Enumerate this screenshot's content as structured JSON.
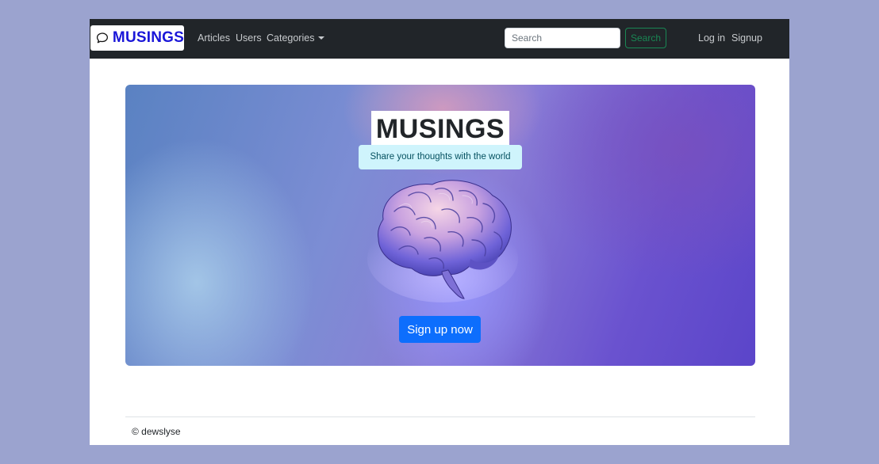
{
  "navbar": {
    "brand": "MUSINGS",
    "brand_icon": "chat-bubble-icon",
    "links": [
      "Articles",
      "Users"
    ],
    "categories_label": "Categories",
    "search_placeholder": "Search",
    "search_value": "",
    "search_button": "Search",
    "login": "Log in",
    "signup": "Signup"
  },
  "hero": {
    "title": "MUSINGS",
    "subtitle": "Share your thoughts with the world",
    "image": "brain-illustration",
    "cta": "Sign up now"
  },
  "footer": {
    "copyright": "© dewslyse"
  },
  "colors": {
    "navbar_bg": "#212529",
    "brand_text": "#1a16d8",
    "search_button": "#198754",
    "cta_bg": "#0d6efd",
    "subtitle_bg": "#cff4fc",
    "page_backdrop": "#9ba3cf"
  }
}
